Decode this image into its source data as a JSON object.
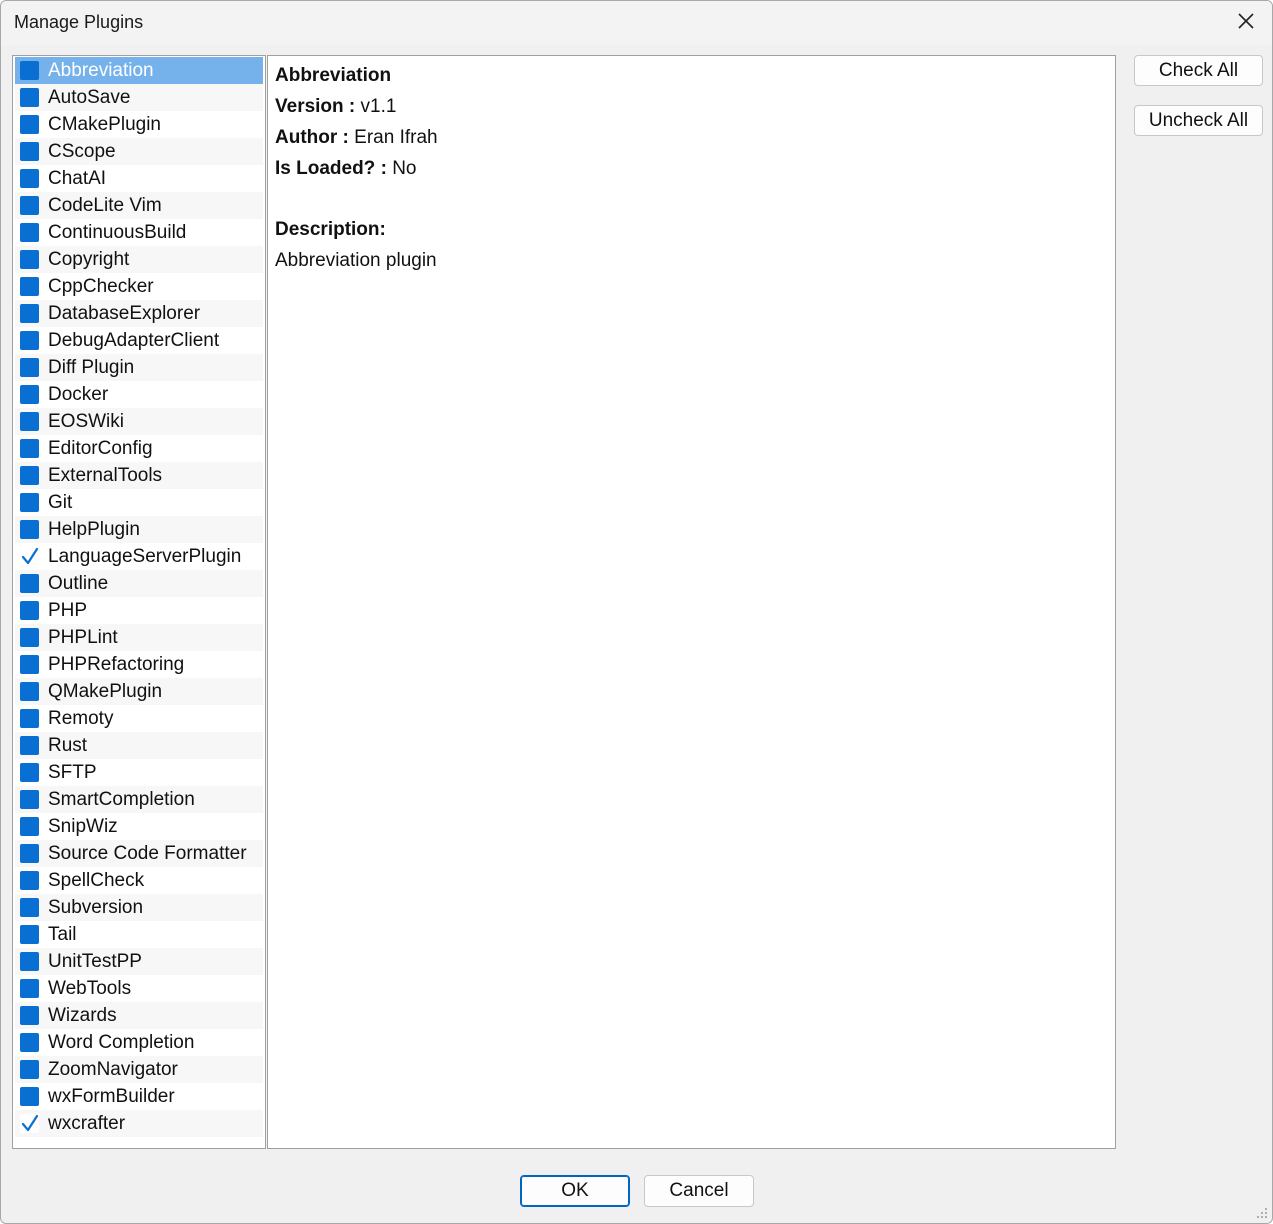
{
  "window": {
    "title": "Manage Plugins"
  },
  "plugins": [
    {
      "label": "Abbreviation",
      "checked": false,
      "selected": true
    },
    {
      "label": "AutoSave",
      "checked": false
    },
    {
      "label": "CMakePlugin",
      "checked": false
    },
    {
      "label": "CScope",
      "checked": false
    },
    {
      "label": "ChatAI",
      "checked": false
    },
    {
      "label": "CodeLite Vim",
      "checked": false
    },
    {
      "label": "ContinuousBuild",
      "checked": false
    },
    {
      "label": "Copyright",
      "checked": false
    },
    {
      "label": "CppChecker",
      "checked": false
    },
    {
      "label": "DatabaseExplorer",
      "checked": false
    },
    {
      "label": "DebugAdapterClient",
      "checked": false
    },
    {
      "label": "Diff Plugin",
      "checked": false
    },
    {
      "label": "Docker",
      "checked": false
    },
    {
      "label": "EOSWiki",
      "checked": false
    },
    {
      "label": "EditorConfig",
      "checked": false
    },
    {
      "label": "ExternalTools",
      "checked": false
    },
    {
      "label": "Git",
      "checked": false
    },
    {
      "label": "HelpPlugin",
      "checked": false
    },
    {
      "label": "LanguageServerPlugin",
      "checked": true
    },
    {
      "label": "Outline",
      "checked": false
    },
    {
      "label": "PHP",
      "checked": false
    },
    {
      "label": "PHPLint",
      "checked": false
    },
    {
      "label": "PHPRefactoring",
      "checked": false
    },
    {
      "label": "QMakePlugin",
      "checked": false
    },
    {
      "label": "Remoty",
      "checked": false
    },
    {
      "label": "Rust",
      "checked": false
    },
    {
      "label": "SFTP",
      "checked": false
    },
    {
      "label": "SmartCompletion",
      "checked": false
    },
    {
      "label": "SnipWiz",
      "checked": false
    },
    {
      "label": "Source Code Formatter",
      "checked": false
    },
    {
      "label": "SpellCheck",
      "checked": false
    },
    {
      "label": "Subversion",
      "checked": false
    },
    {
      "label": "Tail",
      "checked": false
    },
    {
      "label": "UnitTestPP",
      "checked": false
    },
    {
      "label": "WebTools",
      "checked": false
    },
    {
      "label": "Wizards",
      "checked": false
    },
    {
      "label": "Word Completion",
      "checked": false
    },
    {
      "label": "ZoomNavigator",
      "checked": false
    },
    {
      "label": "wxFormBuilder",
      "checked": false
    },
    {
      "label": "wxcrafter",
      "checked": true
    }
  ],
  "details": {
    "name": "Abbreviation",
    "version_label": "Version :",
    "version": "v1.1",
    "author_label": "Author :",
    "author": "Eran Ifrah",
    "loaded_label": "Is Loaded? :",
    "loaded": "No",
    "description_label": "Description:",
    "description": "Abbreviation plugin"
  },
  "buttons": {
    "check_all": "Check All",
    "uncheck_all": "Uncheck All",
    "ok": "OK",
    "cancel": "Cancel"
  },
  "colors": {
    "checkbox_unchecked": "#0a6fd3",
    "selection": "#75b2eb"
  },
  "icons": {
    "close": "close-icon",
    "check": "checkmark-icon"
  }
}
